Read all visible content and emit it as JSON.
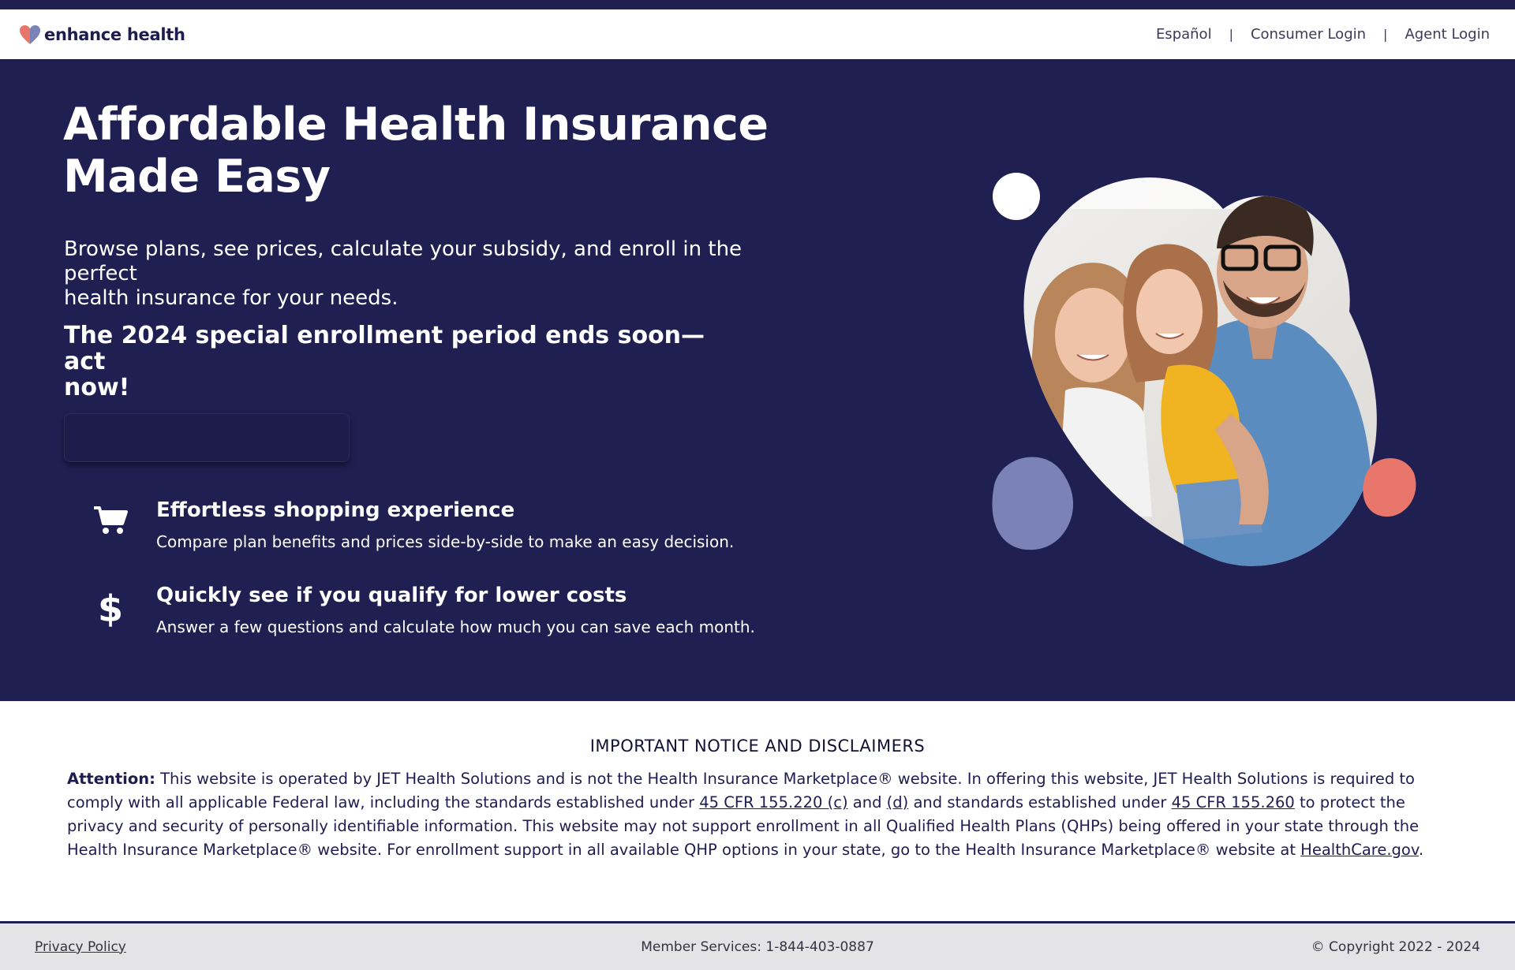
{
  "brand": {
    "name": "enhance health",
    "logo_colors": [
      "#e8766a",
      "#7b82b5"
    ]
  },
  "header": {
    "nav": [
      "Español",
      "Consumer Login",
      "Agent Login"
    ],
    "separator": "|"
  },
  "hero": {
    "title_line1": "Affordable Health Insurance",
    "title_line2": "Made Easy",
    "subtitle_line1": "Browse plans, see prices, calculate your subsidy, and enroll in the perfect",
    "subtitle_line2": "health insurance for your needs.",
    "urgent_line1": "The 2024 special enrollment period ends soon—act",
    "urgent_line2": "now!",
    "cta_label": "",
    "background": "#201f52"
  },
  "features": [
    {
      "icon": "shopping-cart-icon",
      "title": "Effortless shopping experience",
      "description": "Compare plan benefits and prices side-by-side to make an easy decision."
    },
    {
      "icon": "dollar-sign-icon",
      "title": "Quickly see if you qualify for lower costs",
      "description": "Answer a few questions and calculate how much you can save each month."
    }
  ],
  "notice": {
    "heading": "IMPORTANT NOTICE AND DISCLAIMERS",
    "attention_label": "Attention:",
    "text_1": " This website is operated by JET Health Solutions and is not the Health Insurance Marketplace® website. In offering this website, JET Health Solutions is required to comply with all applicable Federal law, including the standards established under ",
    "link_1": "45 CFR 155.220 (c)",
    "text_2": " and ",
    "link_2": "(d)",
    "text_3": " and standards established under ",
    "link_3": "45 CFR 155.260",
    "text_4": " to protect the privacy and security of personally identifiable information. This website may not support enrollment in all Qualified Health Plans (QHPs) being offered in your state through the Health Insurance Marketplace® website. For enrollment support in all available QHP options in your state, go to the Health Insurance Marketplace® website at ",
    "link_4": "HealthCare.gov",
    "text_5": "."
  },
  "footer": {
    "privacy_label": "Privacy Policy",
    "member_services": "Member Services: 1-844-403-0887",
    "copyright": "© Copyright 2022 - 2024"
  }
}
